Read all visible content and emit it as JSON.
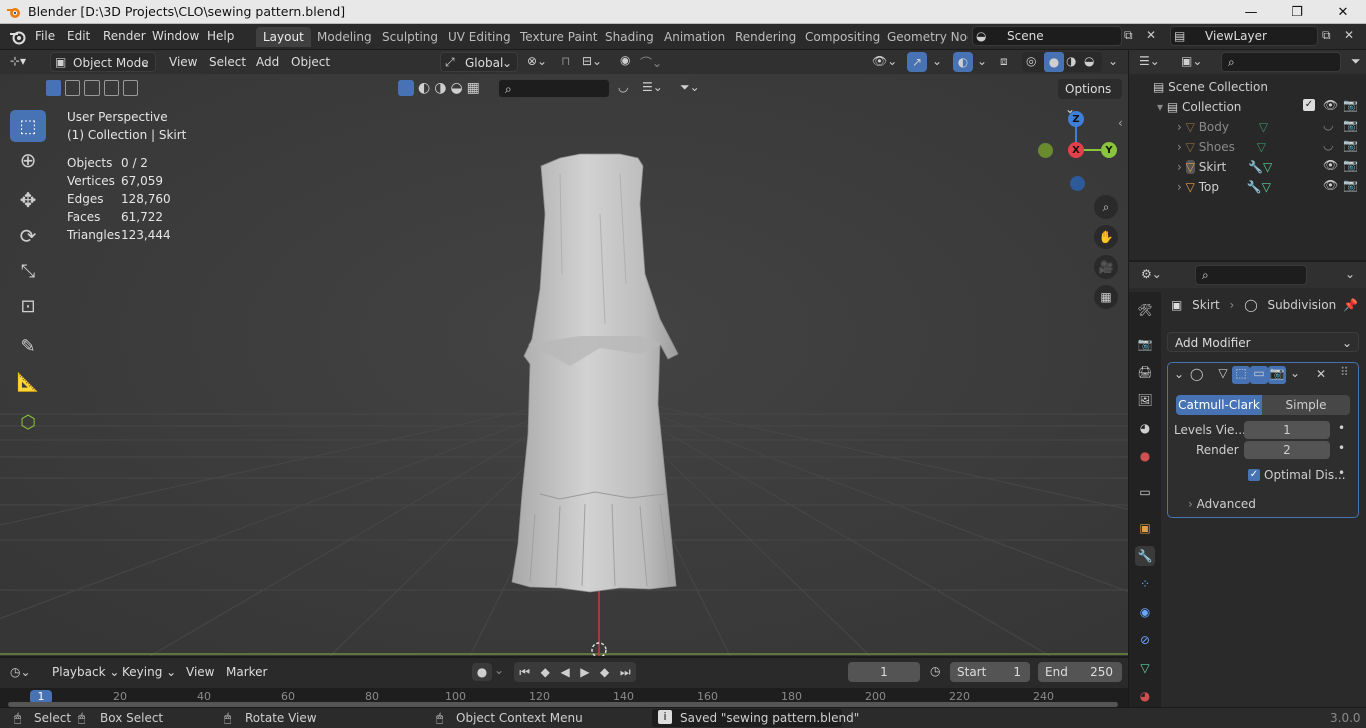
{
  "window": {
    "title": "Blender [D:\\3D Projects\\CLO\\sewing pattern.blend]",
    "minimize": "—",
    "maximize": "❐",
    "close": "✕"
  },
  "menus": [
    "File",
    "Edit",
    "Render",
    "Window",
    "Help"
  ],
  "workspaces": [
    "Layout",
    "Modeling",
    "Sculpting",
    "UV Editing",
    "Texture Paint",
    "Shading",
    "Animation",
    "Rendering",
    "Compositing",
    "Geometry Nod"
  ],
  "active_workspace": "Layout",
  "scene": {
    "name": "Scene",
    "view_layer": "ViewLayer"
  },
  "viewport_header": {
    "mode": "Object Mode",
    "menus": [
      "View",
      "Select",
      "Add",
      "Object"
    ],
    "orientation": "Global",
    "options_label": "Options"
  },
  "overlay_text": {
    "perspective": "User Perspective",
    "collection_info": "(1) Collection | Skirt"
  },
  "stats": [
    {
      "label": "Objects",
      "value": "0 / 2"
    },
    {
      "label": "Vertices",
      "value": "67,059"
    },
    {
      "label": "Edges",
      "value": "128,760"
    },
    {
      "label": "Faces",
      "value": "61,722"
    },
    {
      "label": "Triangles",
      "value": "123,444"
    }
  ],
  "gizmo": {
    "z": "Z",
    "x": "X",
    "y": "Y"
  },
  "outliner": {
    "root": "Scene Collection",
    "collection": "Collection",
    "items": [
      {
        "name": "Body",
        "visible": false
      },
      {
        "name": "Shoes",
        "visible": false
      },
      {
        "name": "Skirt",
        "visible": true
      },
      {
        "name": "Top",
        "visible": true
      }
    ]
  },
  "properties": {
    "breadcrumb_object": "Skirt",
    "breadcrumb_modifier": "Subdivision",
    "add_modifier": "Add Modifier",
    "method_active": "Catmull-Clark",
    "method_other": "Simple",
    "levels_label": "Levels Vie...",
    "levels_value": "1",
    "render_label": "Render",
    "render_value": "2",
    "optimal_label": "Optimal Dis...",
    "advanced_label": "Advanced"
  },
  "timeline": {
    "menus": [
      "Playback",
      "Keying",
      "View",
      "Marker"
    ],
    "current_frame": "1",
    "start_label": "Start",
    "start_value": "1",
    "end_label": "End",
    "end_value": "250",
    "ruler": [
      "1",
      "20",
      "40",
      "60",
      "80",
      "100",
      "120",
      "140",
      "160",
      "180",
      "200",
      "220",
      "240"
    ]
  },
  "statusbar": {
    "select": "Select",
    "box_select": "Box Select",
    "rotate": "Rotate View",
    "context": "Object Context Menu",
    "message": "Saved \"sewing pattern.blend\"",
    "version": "3.0.0"
  },
  "colors": {
    "accent": "#4772b3",
    "axis_x": "#e2404a",
    "axis_y": "#8ac43c",
    "axis_z": "#3d7fd9",
    "object_orange": "#e39c4b",
    "mesh_green": "#5fd3a0"
  }
}
